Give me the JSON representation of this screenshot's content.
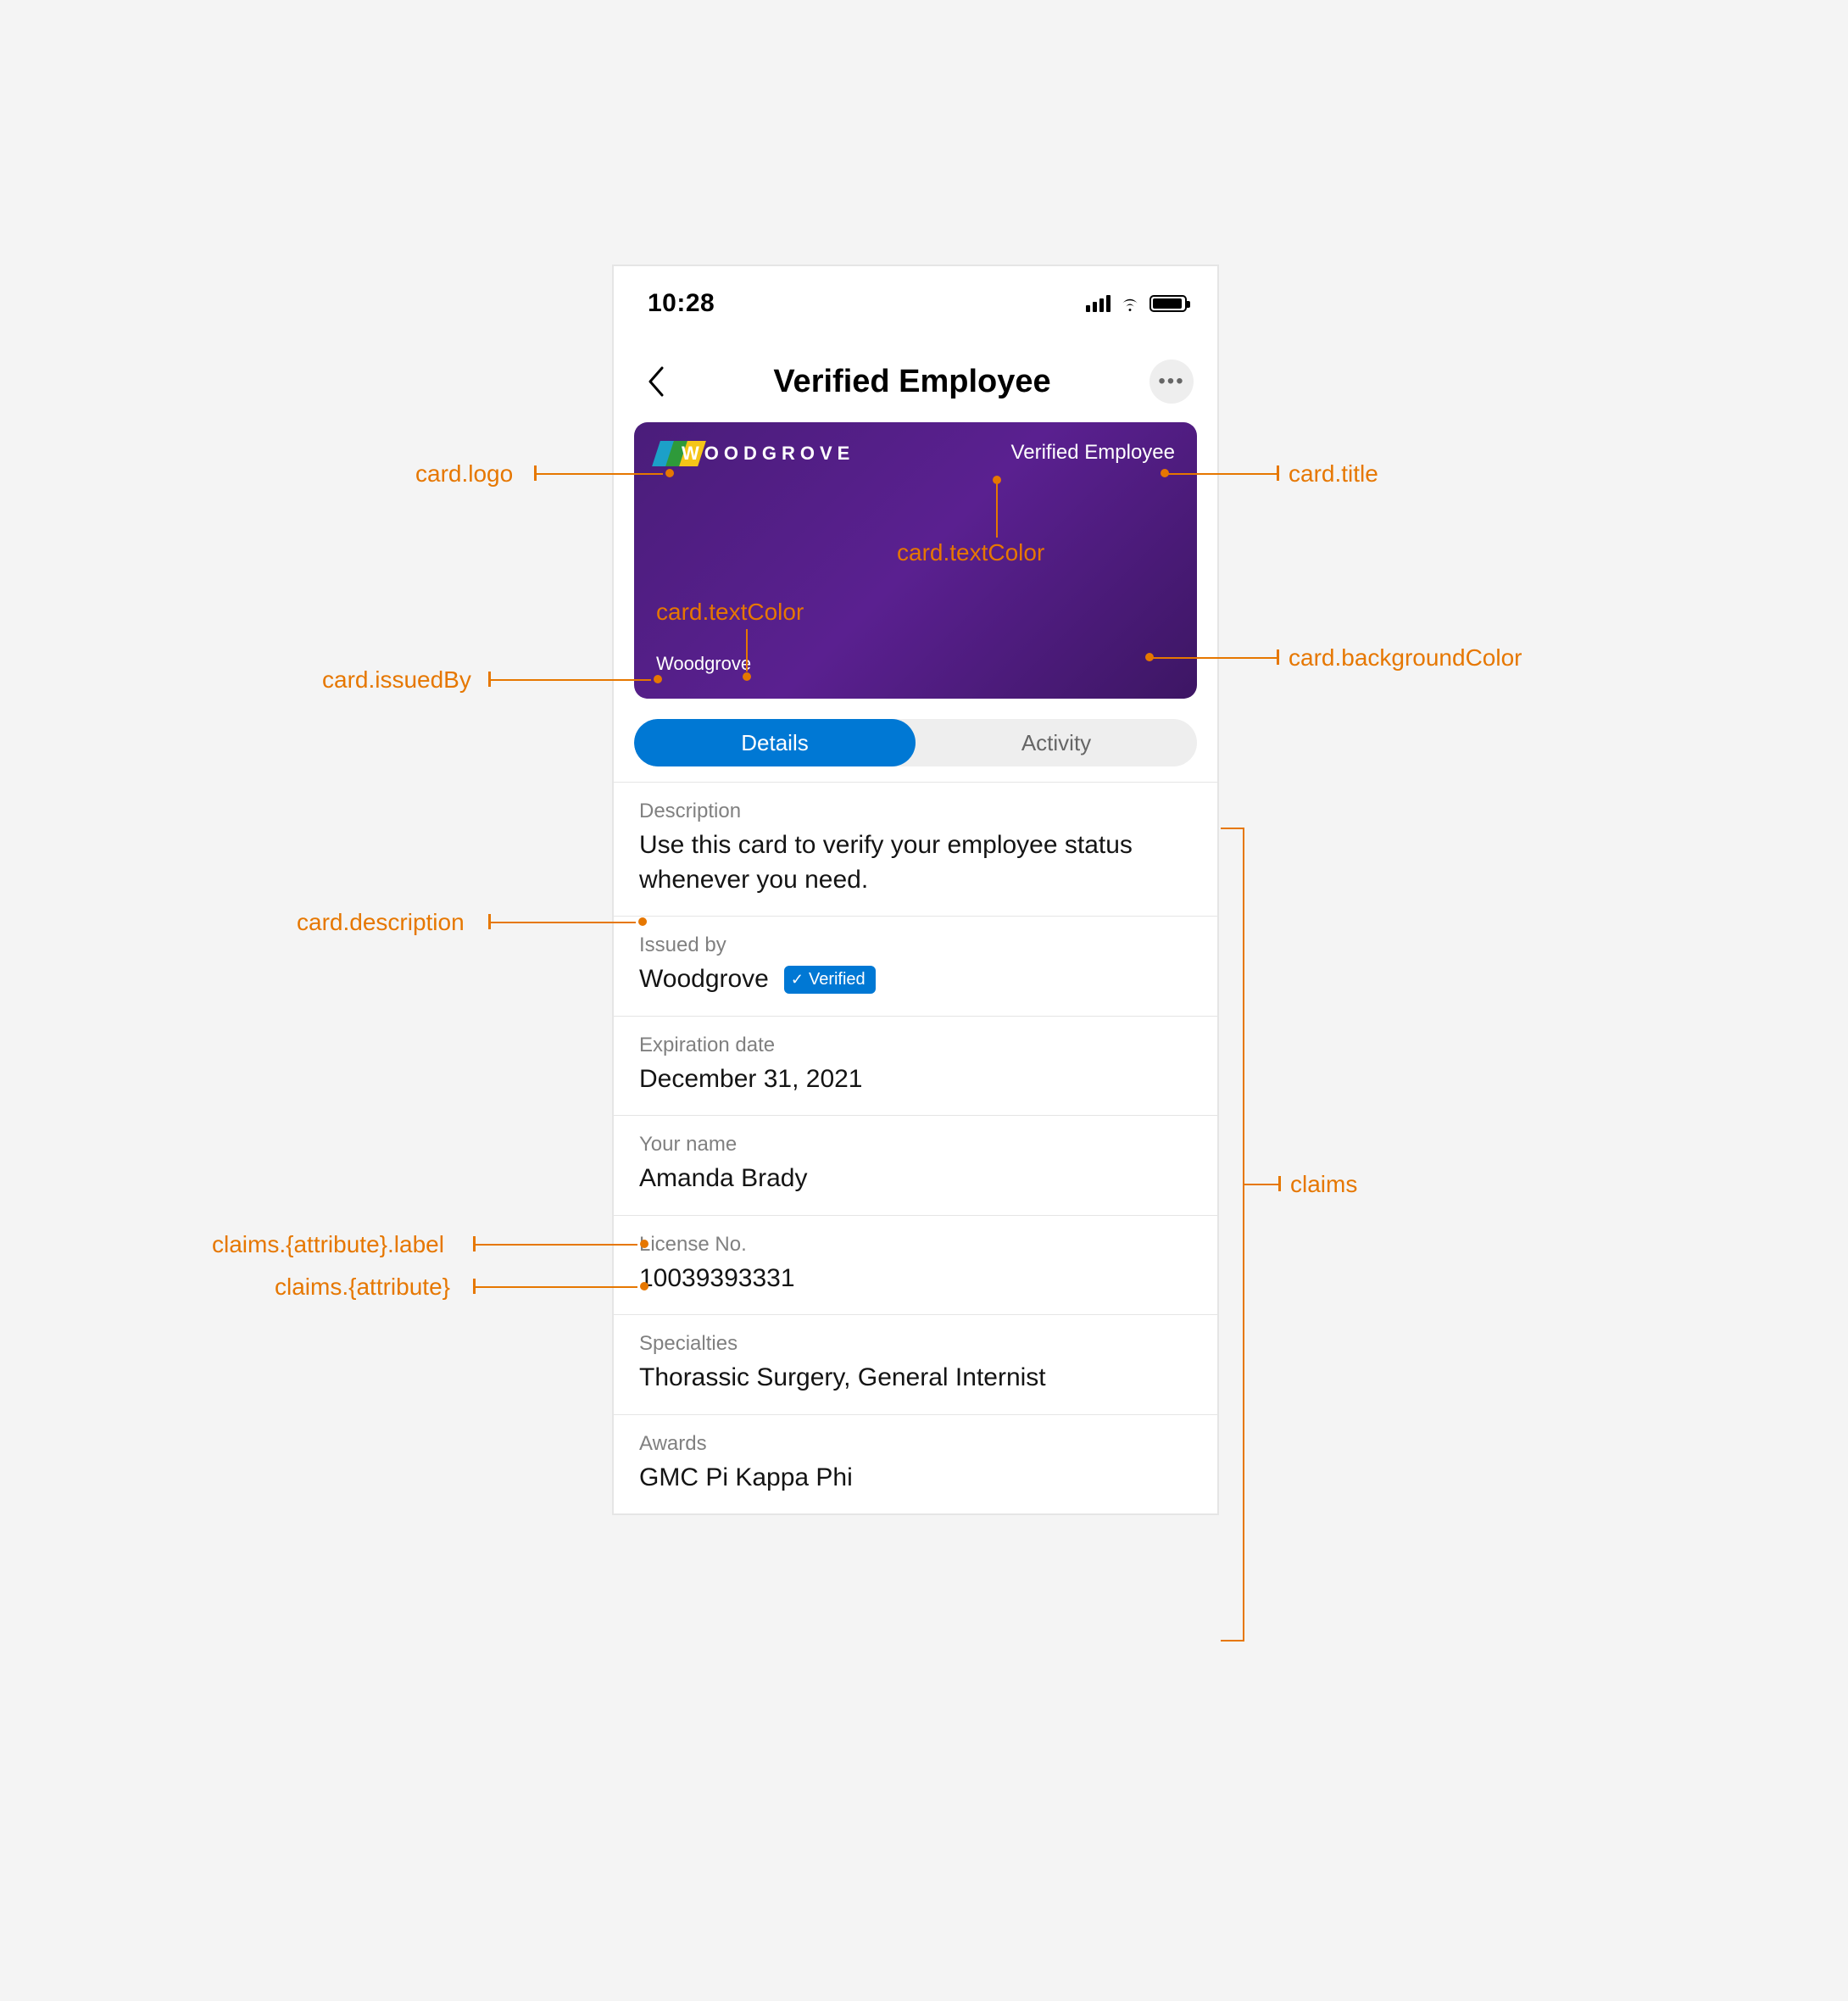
{
  "status": {
    "time": "10:28"
  },
  "nav": {
    "title": "Verified Employee"
  },
  "card": {
    "logo_text": "WOODGROVE",
    "title": "Verified Employee",
    "issued_by": "Woodgrove"
  },
  "tabs": {
    "details": "Details",
    "activity": "Activity"
  },
  "details": {
    "description_label": "Description",
    "description_value": "Use this card to verify your employee status whenever you need.",
    "issued_by_label": "Issued by",
    "issued_by_value": "Woodgrove",
    "verified_badge": "Verified",
    "expiration_label": "Expiration date",
    "expiration_value": "December 31, 2021",
    "name_label": "Your name",
    "name_value": "Amanda Brady",
    "license_label": "License No.",
    "license_value": "10039393331",
    "specialties_label": "Specialties",
    "specialties_value": "Thorassic Surgery, General Internist",
    "awards_label": "Awards",
    "awards_value": "GMC Pi Kappa Phi"
  },
  "annotations": {
    "card_logo": "card.logo",
    "card_title": "card.title",
    "card_textColor1": "card.textColor",
    "card_textColor2": "card.textColor",
    "card_issuedBy": "card.issuedBy",
    "card_backgroundColor": "card.backgroundColor",
    "card_description": "card.description",
    "claims_attribute_label": "claims.{attribute}.label",
    "claims_attribute": "claims.{attribute}",
    "claims": "claims"
  }
}
